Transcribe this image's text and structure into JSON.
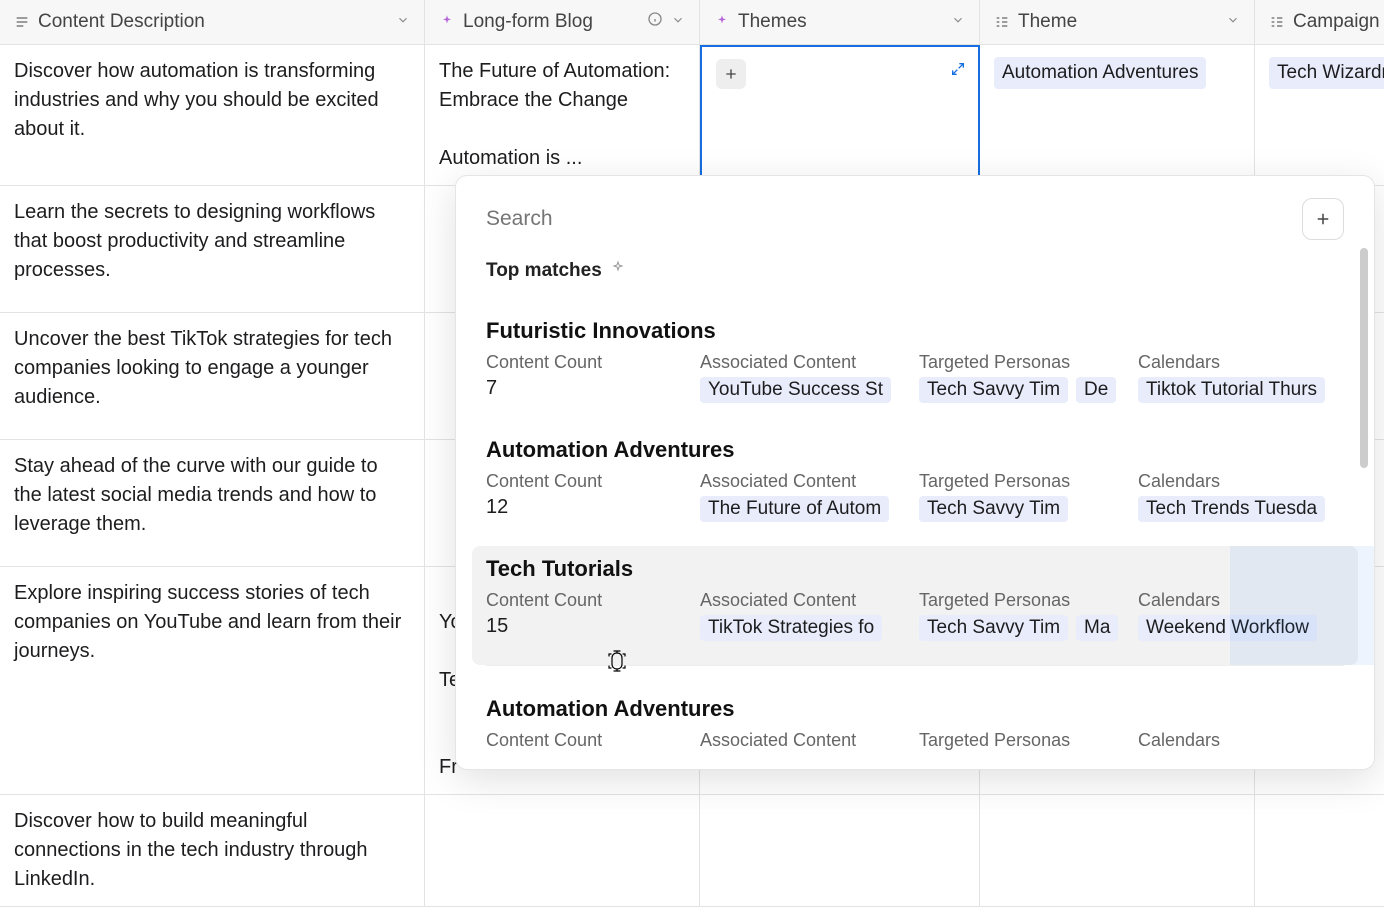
{
  "columns": {
    "c0": "Content Description",
    "c1": "Long-form Blog",
    "c2": "Themes",
    "c3": "Theme",
    "c4": "Campaign"
  },
  "rows": [
    {
      "desc": "Discover how automation is transforming industries and why you should be excited about it.",
      "blog": "The Future of Automation: Embrace the Change\n\nAutomation is ...",
      "theme_tag": "Automation Adventures",
      "campaign_tag": "Tech Wizardr"
    },
    {
      "desc": "Learn the secrets to designing workflows that boost productivity and streamline processes."
    },
    {
      "desc": "Uncover the best TikTok strategies for tech companies looking to engage a younger audience."
    },
    {
      "desc": "Stay ahead of the curve with our guide to the latest social media trends and how to leverage them."
    },
    {
      "desc": "Explore inspiring success stories of tech companies on YouTube and learn from their journeys.",
      "blog_partial_1": "Yo",
      "blog_partial_2": "Te",
      "blog_partial_3": "Fr"
    },
    {
      "desc": "Discover how to build meaningful connections in the tech industry through LinkedIn."
    }
  ],
  "popover": {
    "search_placeholder": "Search",
    "top_matches_label": "Top matches",
    "labels": {
      "content_count": "Content Count",
      "associated_content": "Associated Content",
      "targeted_personas": "Targeted Personas",
      "calendars": "Calendars"
    },
    "matches": [
      {
        "title": "Futuristic Innovations",
        "count": "7",
        "assoc": "YouTube Success St",
        "personas": [
          "Tech Savvy Tim",
          "De"
        ],
        "calendar": "Tiktok Tutorial Thurs"
      },
      {
        "title": "Automation Adventures",
        "count": "12",
        "assoc": "The Future of Autom",
        "personas": [
          "Tech Savvy Tim"
        ],
        "calendar": "Tech Trends Tuesda"
      },
      {
        "title": "Tech Tutorials",
        "count": "15",
        "assoc": "TikTok Strategies fo",
        "personas": [
          "Tech Savvy Tim",
          "Ma"
        ],
        "calendar": "Weekend Workflow"
      },
      {
        "title": "Automation Adventures",
        "count": "",
        "assoc": "",
        "personas": [],
        "calendar": ""
      }
    ]
  }
}
